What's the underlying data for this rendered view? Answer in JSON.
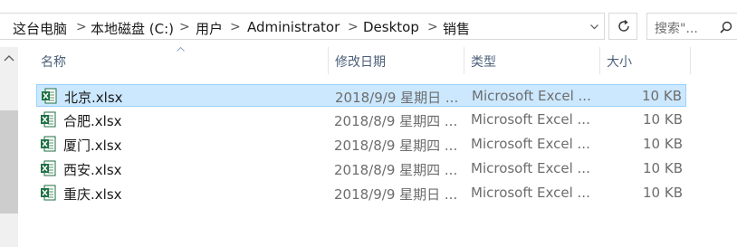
{
  "address_bar": {
    "crumbs": [
      "这台电脑",
      "本地磁盘 (C:)",
      "用户",
      "Administrator",
      "Desktop",
      "销售"
    ],
    "separator": ">"
  },
  "search": {
    "placeholder": "搜索\"..."
  },
  "columns": {
    "name": "名称",
    "modified": "修改日期",
    "type": "类型",
    "size": "大小"
  },
  "files": [
    {
      "name": "北京.xlsx",
      "modified": "2018/9/9 星期日 ...",
      "type": "Microsoft Excel ...",
      "size": "10 KB",
      "selected": true
    },
    {
      "name": "合肥.xlsx",
      "modified": "2018/8/9 星期四 ...",
      "type": "Microsoft Excel ...",
      "size": "10 KB",
      "selected": false
    },
    {
      "name": "厦门.xlsx",
      "modified": "2018/8/9 星期四 ...",
      "type": "Microsoft Excel ...",
      "size": "10 KB",
      "selected": false
    },
    {
      "name": "西安.xlsx",
      "modified": "2018/8/9 星期四 ...",
      "type": "Microsoft Excel ...",
      "size": "10 KB",
      "selected": false
    },
    {
      "name": "重庆.xlsx",
      "modified": "2018/9/9 星期日 ...",
      "type": "Microsoft Excel ...",
      "size": "10 KB",
      "selected": false
    }
  ],
  "icons": {
    "file": "excel-file-icon",
    "refresh": "refresh-icon",
    "search": "search-icon",
    "dropdown": "chevron-down-icon",
    "sort": "sort-up-icon",
    "scroll_up": "chevron-up-icon"
  },
  "colors": {
    "selection": "#cce8ff",
    "selection_border": "#99d1ff",
    "excel_green": "#1d6f42",
    "header_text": "#4c607a"
  }
}
